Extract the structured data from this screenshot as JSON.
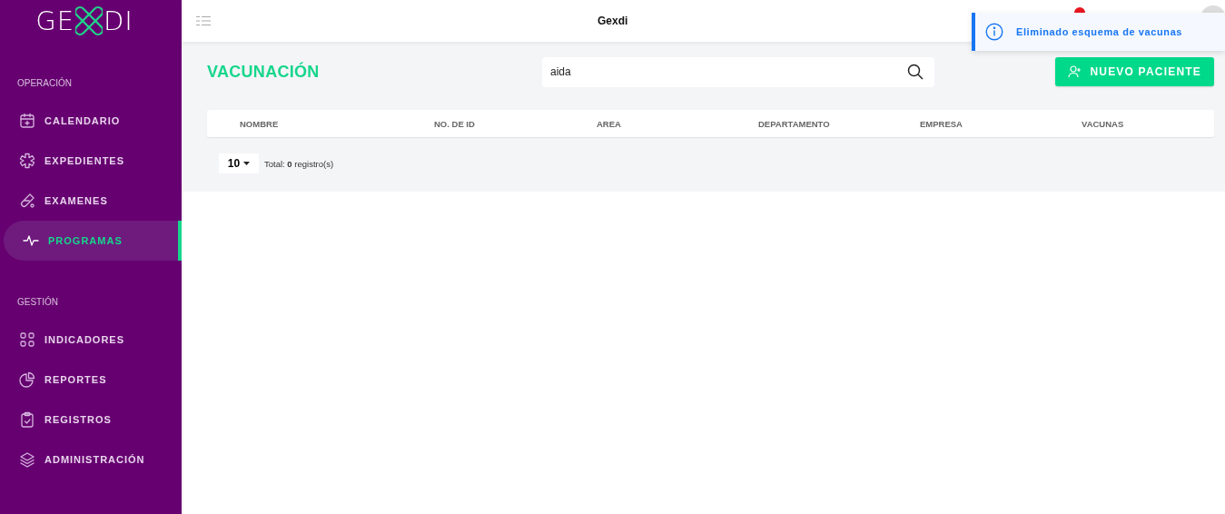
{
  "logo": {
    "left": "GE",
    "right": "DI"
  },
  "sidebar": {
    "sections": [
      {
        "title": "OPERACIÓN",
        "items": [
          {
            "label": "CALENDARIO",
            "kind": "calendar",
            "selected": false
          },
          {
            "label": "EXPEDIENTES",
            "kind": "asterisk",
            "selected": false
          },
          {
            "label": "EXAMENES",
            "kind": "tube",
            "selected": false
          },
          {
            "label": "PROGRAMAS",
            "kind": "pulse",
            "selected": true
          }
        ]
      },
      {
        "title": "GESTIÓN",
        "items": [
          {
            "label": "INDICADORES",
            "kind": "grid",
            "selected": false
          },
          {
            "label": "REPORTES",
            "kind": "pie",
            "selected": false
          },
          {
            "label": "REGISTROS",
            "kind": "clipboard",
            "selected": false
          },
          {
            "label": "ADMINISTRACIÓN",
            "kind": "layers",
            "selected": false
          }
        ]
      }
    ]
  },
  "header": {
    "title": "Gexdi"
  },
  "toast": {
    "message": "Eliminado esquema de vacunas"
  },
  "page": {
    "title": "VACUNACIÓN",
    "search": {
      "value": "aida"
    },
    "new_button": "NUEVO PACIENTE"
  },
  "table": {
    "columns": [
      "NOMBRE",
      "NO. DE ID",
      "AREA",
      "DEPARTAMENTO",
      "EMPRESA",
      "VACUNAS"
    ]
  },
  "pagination": {
    "page_size": "10",
    "total_prefix": "Total:",
    "total_count": "0",
    "total_suffix": "registro(s)"
  }
}
